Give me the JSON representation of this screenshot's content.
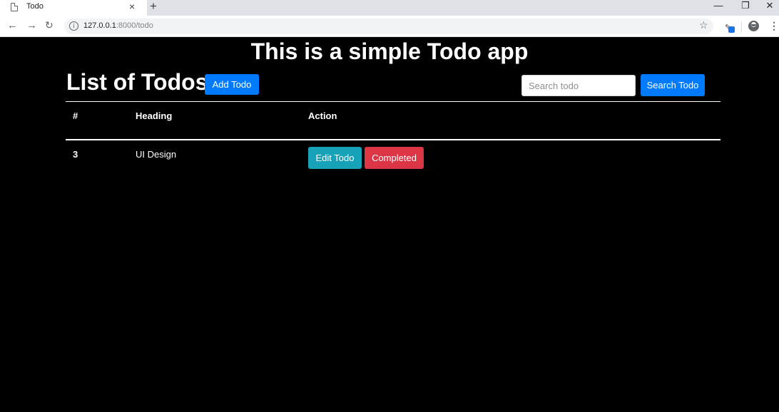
{
  "browser": {
    "tab_title": "Todo",
    "tab_close": "×",
    "new_tab": "+",
    "url_host": "127.0.0.1",
    "url_path": ":8000/todo",
    "window_minimize": "—",
    "window_restore": "❐",
    "window_close": "✕"
  },
  "page": {
    "app_title": "This is a simple Todo app",
    "list_title": "List of Todos",
    "add_button": "Add Todo",
    "search_placeholder": "Search todo",
    "search_button": "Search Todo"
  },
  "table": {
    "headers": [
      "#",
      "Heading",
      "Action"
    ],
    "rows": [
      {
        "id": "3",
        "heading": "UI Design",
        "edit_label": "Edit Todo",
        "complete_label": "Completed"
      }
    ]
  },
  "colors": {
    "primary": "#007bff",
    "info": "#17a2b8",
    "danger": "#dc3545",
    "background": "#000000"
  }
}
